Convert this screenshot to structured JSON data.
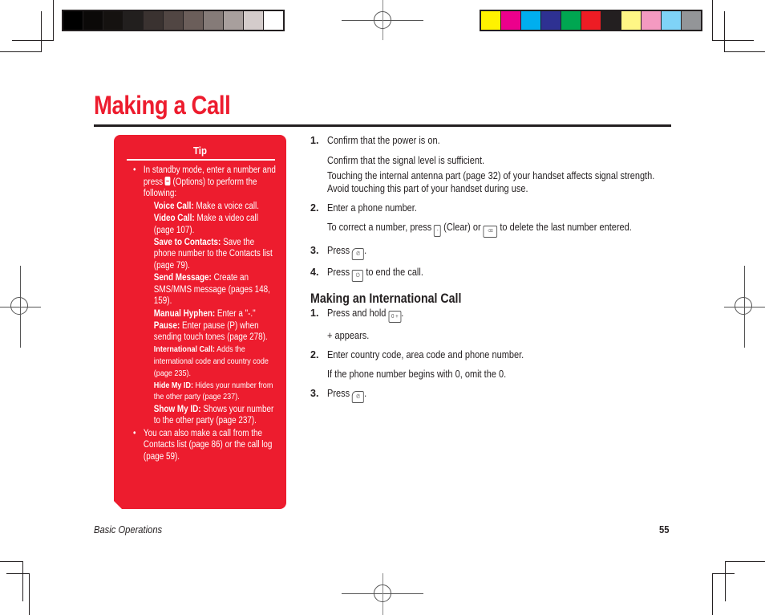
{
  "page": {
    "title": "Making a Call",
    "footer": {
      "section": "Basic Operations",
      "page_number": "55"
    }
  },
  "print_marks": {
    "grayscale_swatches": [
      "#000000",
      "#0b0908",
      "#151210",
      "#221f1e",
      "#3a3230",
      "#514643",
      "#6b5e5a",
      "#857b78",
      "#a89f9d",
      "#d4cccb",
      "#ffffff"
    ],
    "color_swatches": [
      "#fff200",
      "#ec008c",
      "#00aeef",
      "#2e3192",
      "#00a651",
      "#ed1c24",
      "#231f20",
      "#fff685",
      "#f49ac1",
      "#7fd3f7",
      "#939598"
    ]
  },
  "tip": {
    "heading": "Tip",
    "bullets": [
      {
        "text_before_icon": "In standby mode, enter a number and press",
        "icon": "softkey-icon",
        "text_after_icon": "(Options) to perform the following:",
        "options": [
          {
            "label": "Voice Call:",
            "desc": "Make a voice call."
          },
          {
            "label": "Video Call:",
            "desc": "Make a video call (page 107)."
          },
          {
            "label": "Save to Contacts:",
            "desc": "Save the phone number to the Contacts list (page 79)."
          },
          {
            "label": "Send Message:",
            "desc": "Create an SMS/MMS message (pages 148, 159)."
          },
          {
            "label": "Manual Hyphen:",
            "desc": "Enter a \"-.\""
          },
          {
            "label": "Pause:",
            "desc": "Enter pause (P) when sending touch tones (page 278)."
          },
          {
            "label": "International Call:",
            "desc": "Adds the international code and country code (page 235)."
          },
          {
            "label": "Hide My ID:",
            "desc": "Hides your number from the other party (page 237)."
          },
          {
            "label": "Show My ID:",
            "desc": "Shows your number to the other party (page 237)."
          }
        ]
      },
      {
        "text": "You can also make a call from the Contacts list (page 86) or the call log (page 59)."
      }
    ]
  },
  "steps": [
    {
      "num": "1.",
      "text": "Confirm that the power is on.",
      "notes": [
        "Confirm that the signal level is sufficient.",
        "Touching the internal antenna part (page 32) of your handset affects signal strength.",
        "Avoid touching this part of your handset during use."
      ]
    },
    {
      "num": "2.",
      "text": "Enter a phone number.",
      "note_parts": [
        "To correct a number, press",
        "(Clear) or",
        "to delete the last number entered."
      ],
      "note_icons": [
        "clear-softkey-icon",
        "backspace-key-icon"
      ]
    },
    {
      "num": "3.",
      "text_before": "Press",
      "text_after": ".",
      "icon": "call-send-key-icon"
    },
    {
      "num": "4.",
      "text_before": "Press",
      "text_after": "to end the call.",
      "icon": "end-power-key-icon"
    }
  ],
  "international": {
    "heading": "Making an International Call",
    "steps": [
      {
        "num": "1.",
        "text_before": "Press and hold",
        "text_after": ".",
        "icon": "zero-plus-key-icon",
        "note": "+ appears."
      },
      {
        "num": "2.",
        "text": "Enter country code, area code and phone number.",
        "note": "If the phone number begins with 0, omit the 0."
      },
      {
        "num": "3.",
        "text_before": "Press",
        "text_after": ".",
        "icon": "call-send-key-icon"
      }
    ]
  },
  "colors": {
    "accent_red": "#ed1c2e",
    "text": "#231f20"
  }
}
